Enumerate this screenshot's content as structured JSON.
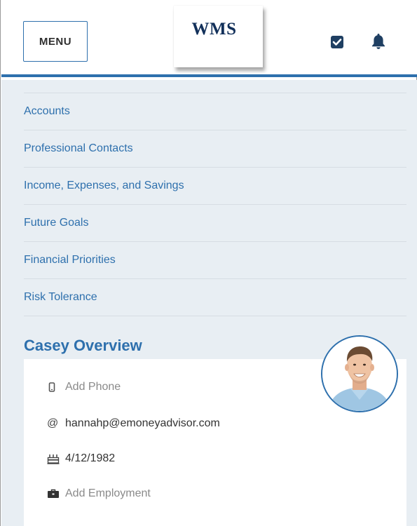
{
  "header": {
    "menu_label": "MENU",
    "logo_text": "WMS",
    "tasks_icon": "checkbox-icon",
    "notifications_icon": "bell-icon"
  },
  "nav": {
    "items": [
      {
        "label": "Accounts"
      },
      {
        "label": "Professional Contacts"
      },
      {
        "label": "Income, Expenses, and Savings"
      },
      {
        "label": "Future Goals"
      },
      {
        "label": "Financial Priorities"
      },
      {
        "label": "Risk Tolerance"
      }
    ]
  },
  "overview": {
    "title": "Casey Overview",
    "phone": {
      "icon": "phone-icon",
      "text": "Add Phone"
    },
    "email": {
      "icon": "at-icon",
      "text": "hannahp@emoneyadvisor.com"
    },
    "birthday": {
      "icon": "cake-icon",
      "text": "4/12/1982"
    },
    "employment": {
      "icon": "briefcase-icon",
      "text": "Add Employment"
    },
    "avatar_icon": "profile-photo"
  },
  "colors": {
    "accent": "#2e70ad",
    "content_bg": "#e8eef3",
    "muted_text": "#8a8a8a",
    "logo": "#12305a"
  }
}
